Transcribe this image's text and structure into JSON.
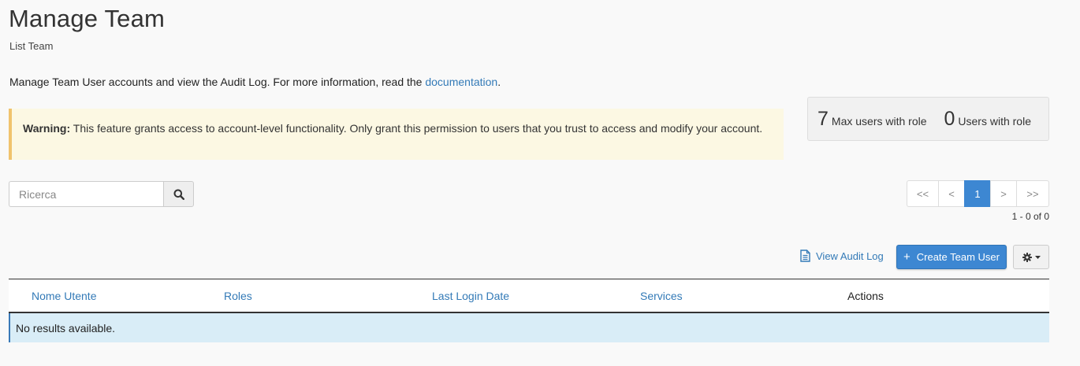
{
  "header": {
    "title": "Manage Team",
    "subtitle": "List Team"
  },
  "intro": {
    "text": "Manage Team User accounts and view the Audit Log. For more information, read the ",
    "link": "documentation",
    "end": "."
  },
  "warning": {
    "label": "Warning:",
    "text": " This feature grants access to account-level functionality. Only grant this permission to users that you trust to access and modify your account."
  },
  "stats": [
    {
      "value": "7",
      "label": "Max users with role"
    },
    {
      "value": "0",
      "label": "Users with role"
    }
  ],
  "search": {
    "placeholder": "Ricerca",
    "icon": "search-icon"
  },
  "pagination": {
    "first": "<<",
    "prev": "<",
    "current": "1",
    "next": ">",
    "last": ">>",
    "info": "1 - 0 of 0",
    "active_color": "#3d87d2"
  },
  "toolbar": {
    "audit_label": "View Audit Log",
    "create_plus": "+",
    "create_label": "Create Team User",
    "settings_icon": "gear-icon"
  },
  "table": {
    "columns": [
      "Nome Utente",
      "Roles",
      "Last Login Date",
      "Services",
      "Actions"
    ],
    "empty_message": "No results available."
  },
  "colors": {
    "link": "#337ab7",
    "primary": "#3d87d2",
    "warning_bg": "#fcf8e3",
    "info_bg": "#d9edf7"
  }
}
